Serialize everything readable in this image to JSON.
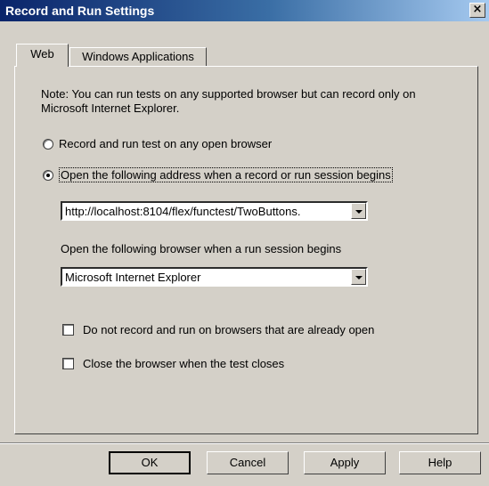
{
  "window": {
    "title": "Record and Run Settings",
    "close_label": "×"
  },
  "tabs": [
    {
      "label": "Web"
    },
    {
      "label": "Windows Applications"
    }
  ],
  "note": "Note: You can run tests on any supported browser but can record only on Microsoft Internet Explorer.",
  "radio_any": {
    "label": "Record and run test on any open browser",
    "selected": false
  },
  "radio_open": {
    "label": "Open the following address when a record or run session begins",
    "selected": true
  },
  "address_combo": {
    "value": "http://localhost:8104/flex/functest/TwoButtons."
  },
  "browser_label": "Open the following browser when a run session begins",
  "browser_combo": {
    "value": "Microsoft Internet Explorer"
  },
  "check_open": {
    "label": "Do not record and run on browsers that are already open",
    "checked": false
  },
  "check_close": {
    "label": "Close the browser when the test closes",
    "checked": false
  },
  "buttons": {
    "ok": "OK",
    "cancel": "Cancel",
    "apply": "Apply",
    "help": "Help"
  }
}
